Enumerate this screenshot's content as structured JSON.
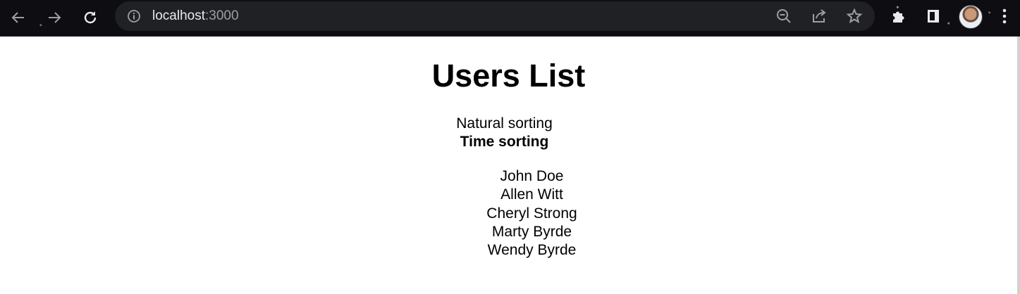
{
  "browser": {
    "url_host": "localhost",
    "url_port": ":3000"
  },
  "page": {
    "title": "Users List",
    "sort_options": [
      {
        "label": "Natural sorting",
        "active": false
      },
      {
        "label": "Time sorting",
        "active": true
      }
    ],
    "users": [
      "John Doe",
      "Allen Witt",
      "Cheryl Strong",
      "Marty Byrde",
      "Wendy Byrde"
    ]
  }
}
